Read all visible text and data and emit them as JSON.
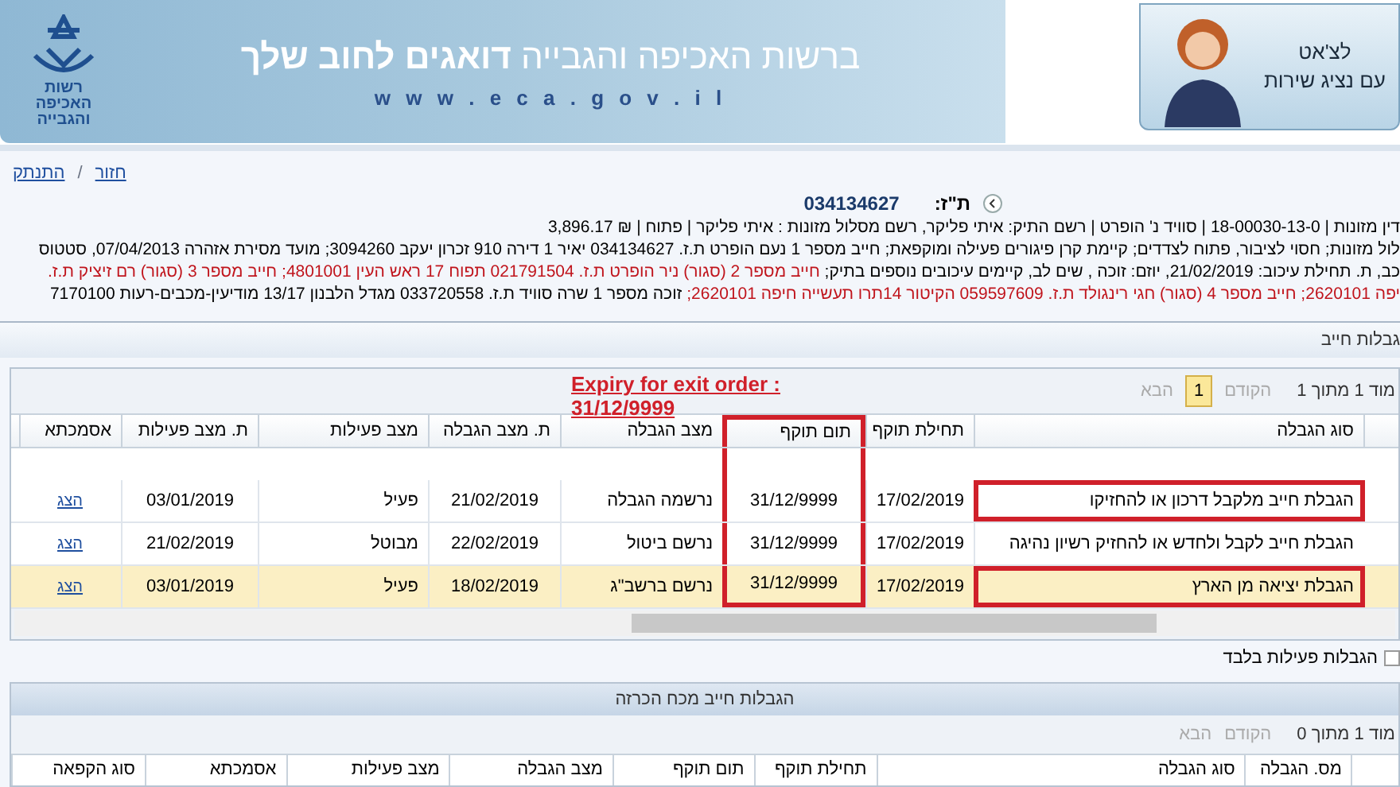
{
  "header": {
    "logo_text": "רשות האכיפה והגבייה",
    "slogan": "ברשות האכיפה והגבייה **דואגים לחוב שלך**",
    "url": "w w w . e c a . g o v . i l",
    "chat": {
      "line1": "לצ'אט",
      "line2": "עם נציג שירות"
    }
  },
  "nav": {
    "links": [
      {
        "label": "חזור"
      },
      {
        "label": "התנתק"
      }
    ],
    "separator": "/"
  },
  "case": {
    "id_label": "ת\"ז:",
    "id_value": "034134627",
    "lines": [
      [
        {
          "kind": "normal",
          "text": "דין מזונות | 18-00030-13-0 | סוויד נ' הופרט | רשם התיק: איתי פליקר, רשם מסלול מזונות : איתי פליקר | פתוח | ₪ 3,896.17"
        }
      ],
      [
        {
          "kind": "normal",
          "text": "לול מזונות; חסוי לציבור, פתוח לצדדים; קיימת קרן פיגורים פעילה ומוקפאת; חייב מספר 1 נעם הופרט ת.ז. 034134627 יאיר 1 דירה 910 זכרון יעקב 3094260; מועד מסירת אזהרה 07/04/2013, סטטוס"
        }
      ],
      [
        {
          "kind": "normal",
          "text": "כב, ת. תחילת עיכוב: 21/02/2019, יוזם: זוכה , שים לב, קיימים עיכובים נוספים בתיק; "
        },
        {
          "kind": "warning",
          "text": "חייב מספר 2 (סגור) ניר הופרט ת.ז. 021791504 תפוח 17 ראש העין 4801001; חייב מספר 3 (סגור) רם זיציק ת.ז."
        }
      ],
      [
        {
          "kind": "warning",
          "text": "יפה 2620101; חייב מספר 4 (סגור) חגי רינגולד ת.ז. 059597609 הקיטור 14תרו תעשייה חיפה 2620101;"
        },
        {
          "kind": "normal",
          "text": " זוכה מספר 1 שרה סוויד ת.ז. 033720558 מגדל הלבנון 13/17 מודיעין-מכבים-רעות 7170100"
        }
      ]
    ]
  },
  "restrictions": {
    "title": "גבלות חייב",
    "pager": {
      "page_text": "מוד 1 מתוך 1",
      "prev": "הקודם",
      "current": "1",
      "next": "הבא"
    },
    "annotation": "Expiry for exit order : 31/12/9999",
    "columns": [
      {
        "label": "סוג הגבלה",
        "annotated": false
      },
      {
        "label": "תחילת תוקף",
        "annotated": false
      },
      {
        "label": "תום תוקף",
        "annotated": true
      },
      {
        "label": "מצב הגבלה",
        "annotated": false
      },
      {
        "label": "ת. מצב הגבלה",
        "annotated": false
      },
      {
        "label": "מצב פעילות",
        "annotated": false
      },
      {
        "label": "ת. מצב פעילות",
        "annotated": false
      },
      {
        "label": "אסמכתא",
        "annotated": false
      }
    ],
    "rows": [
      {
        "cells": [
          "הגבלת חייב מלקבל דרכון או להחזיקו",
          "17/02/2019",
          "31/12/9999",
          "נרשמה הגבלה",
          "21/02/2019",
          "פעיל",
          "03/01/2019"
        ],
        "link": "הצג",
        "selected": false,
        "annotated": true
      },
      {
        "cells": [
          "הגבלת חייב לקבל ולחדש או להחזיק רשיון נהיגה",
          "17/02/2019",
          "31/12/9999",
          "נרשם ביטול",
          "22/02/2019",
          "מבוטל",
          "21/02/2019"
        ],
        "link": "הצג",
        "selected": false,
        "annotated": false
      },
      {
        "cells": [
          "הגבלת יציאה מן הארץ",
          "17/02/2019",
          "31/12/9999",
          "נרשם ברשב\"ג",
          "18/02/2019",
          "פעיל",
          "03/01/2019"
        ],
        "link": "הצג",
        "selected": true,
        "annotated": true
      }
    ]
  },
  "active_only": {
    "label": "הגבלות פעילות בלבד",
    "checked": false
  },
  "declared": {
    "title": "הגבלות חייב מכח הכרזה",
    "pager": {
      "page_text": "מוד 1 מתוך 0",
      "prev": "הקודם",
      "next": "הבא"
    },
    "columns": [
      "מס. הגבלה",
      "סוג הגבלה",
      "תחילת תוקף",
      "תום תוקף",
      "מצב הגבלה",
      "מצב פעילות",
      "אסמכתא",
      "סוג הקפאה"
    ]
  }
}
